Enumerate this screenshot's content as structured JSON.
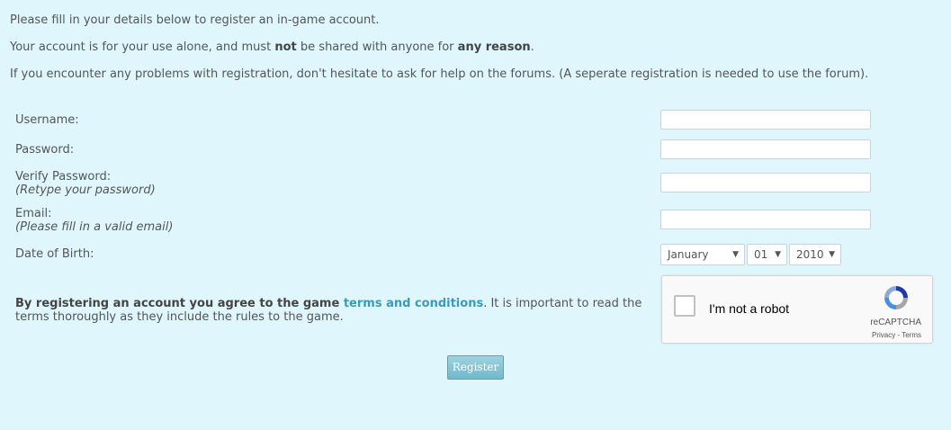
{
  "intro": {
    "line1": "Please fill in your details below to register an in-game account.",
    "line2_pre": "Your account is for your use alone, and must ",
    "line2_bold1": "not",
    "line2_mid": " be shared with anyone for ",
    "line2_bold2": "any reason",
    "line2_post": ".",
    "line3": "If you encounter any problems with registration, don't hesitate to ask for help on the forums. (A seperate registration is needed to use the forum)."
  },
  "form": {
    "username_label": "Username:",
    "password_label": "Password:",
    "verify_label": "Verify Password:",
    "verify_hint": "(Retype your password)",
    "email_label": "Email:",
    "email_hint": "(Please fill in a valid email)",
    "dob_label": "Date of Birth:",
    "dob_month": "January",
    "dob_day": "01",
    "dob_year": "2010"
  },
  "terms": {
    "pre": "By registering an account you agree to the game ",
    "link": "terms and conditions",
    "post": ". It is important to read the terms thoroughly as they include the rules to the game."
  },
  "captcha": {
    "label": "I'm not a robot",
    "brand": "reCAPTCHA",
    "privacy": "Privacy",
    "sep": " - ",
    "terms": "Terms"
  },
  "register_label": "Register",
  "colors": {
    "background": "#dff6fc",
    "link": "#3b9bb8",
    "button": "#7fc3d4"
  }
}
